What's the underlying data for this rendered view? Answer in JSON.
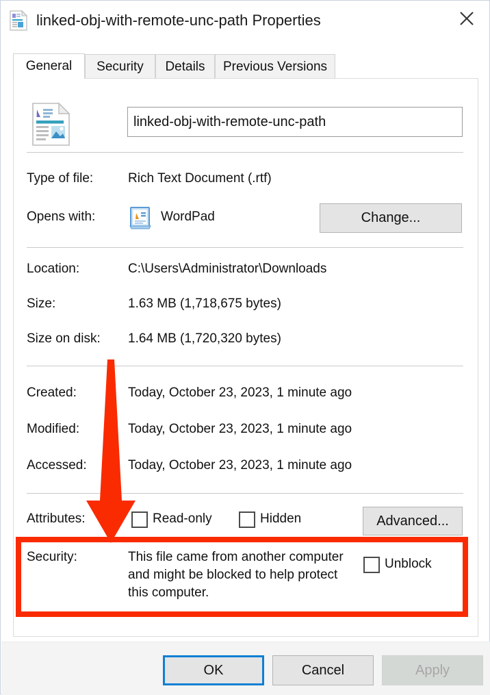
{
  "window": {
    "title": "linked-obj-with-remote-unc-path Properties",
    "icon": "rtf-document-icon",
    "close_icon": "close-icon"
  },
  "tabs": [
    {
      "label": "General",
      "active": true
    },
    {
      "label": "Security",
      "active": false
    },
    {
      "label": "Details",
      "active": false
    },
    {
      "label": "Previous Versions",
      "active": false
    }
  ],
  "general": {
    "filename": {
      "icon": "rtf-document-icon",
      "value": "linked-obj-with-remote-unc-path"
    },
    "type_of_file": {
      "label": "Type of file:",
      "value": "Rich Text Document (.rtf)"
    },
    "opens_with": {
      "label": "Opens with:",
      "app_icon": "wordpad-icon",
      "app_name": "WordPad",
      "change_button": "Change..."
    },
    "location": {
      "label": "Location:",
      "value": "C:\\Users\\Administrator\\Downloads"
    },
    "size": {
      "label": "Size:",
      "value": "1.63 MB (1,718,675 bytes)"
    },
    "size_on_disk": {
      "label": "Size on disk:",
      "value": "1.64 MB (1,720,320 bytes)"
    },
    "created": {
      "label": "Created:",
      "value": "Today, October 23, 2023, 1 minute ago"
    },
    "modified": {
      "label": "Modified:",
      "value": "Today, October 23, 2023, 1 minute ago"
    },
    "accessed": {
      "label": "Accessed:",
      "value": "Today, October 23, 2023, 1 minute ago"
    },
    "attributes": {
      "label": "Attributes:",
      "read_only": {
        "label": "Read-only",
        "checked": false
      },
      "hidden": {
        "label": "Hidden",
        "checked": false
      },
      "advanced_button": "Advanced..."
    },
    "security": {
      "label": "Security:",
      "message": "This file came from another computer and might be blocked to help protect this computer.",
      "unblock": {
        "label": "Unblock",
        "checked": false
      }
    }
  },
  "footer": {
    "ok": "OK",
    "cancel": "Cancel",
    "apply": "Apply",
    "apply_disabled": true
  },
  "annotation": {
    "highlight_color": "#fa2b00",
    "arrow": "down-arrow-annotation",
    "box": "security-row-highlight"
  }
}
